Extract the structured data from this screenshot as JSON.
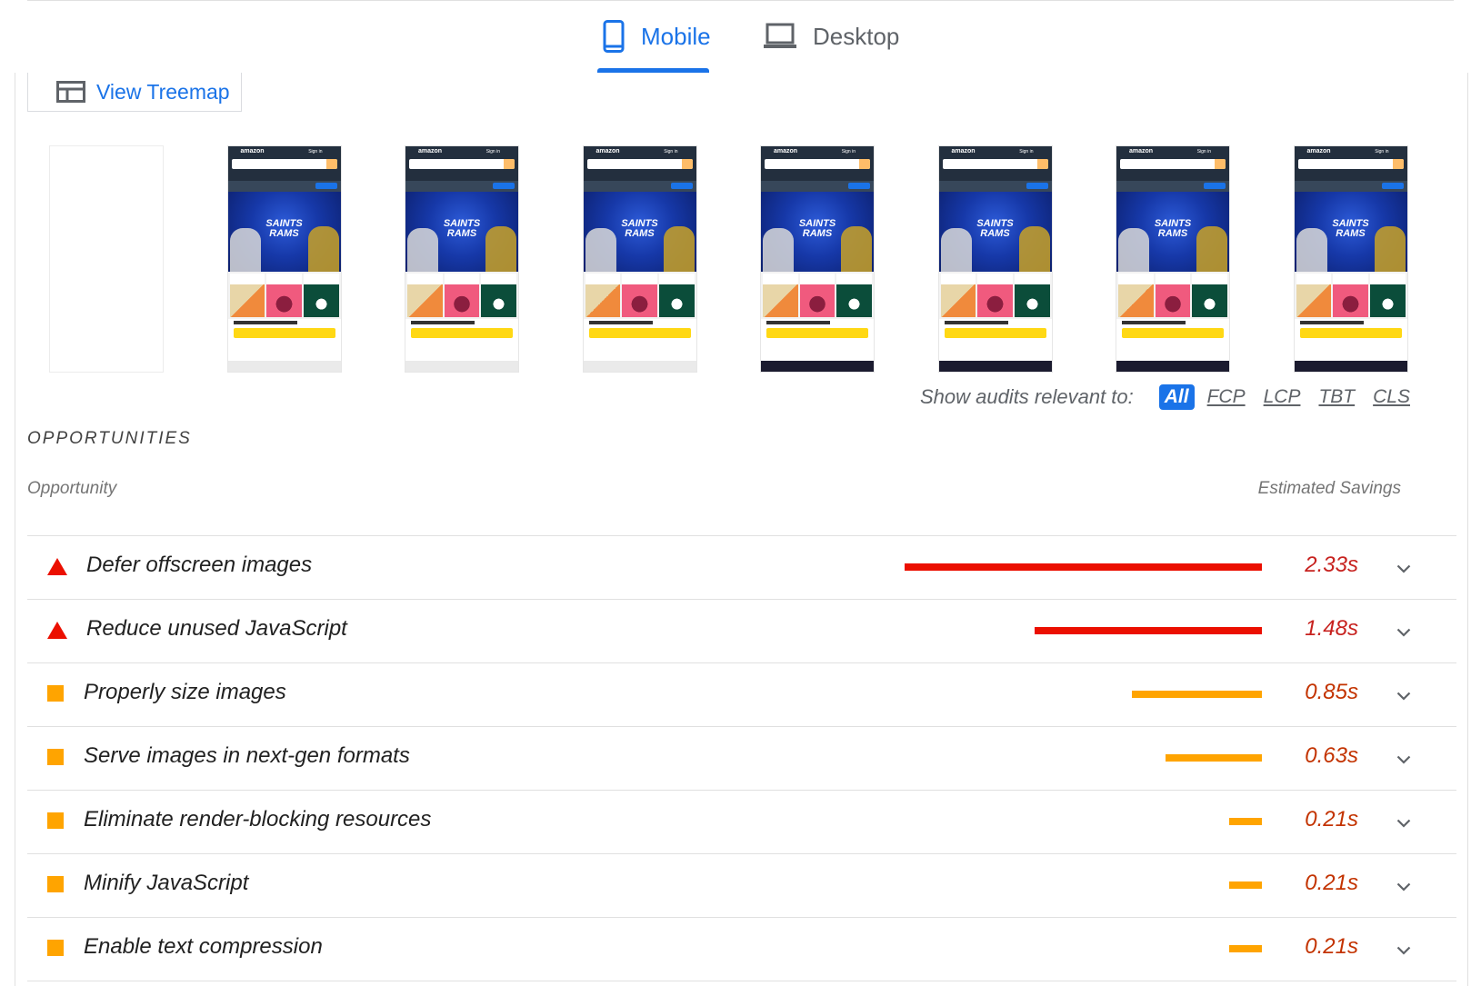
{
  "tabs": {
    "mobile_label": "Mobile",
    "desktop_label": "Desktop",
    "active": "Mobile",
    "accent_color": "#1a73e8"
  },
  "treemap": {
    "label": "View Treemap"
  },
  "filmstrip": {
    "frames": [
      {
        "state": "blank"
      },
      {
        "state": "loaded"
      },
      {
        "state": "loaded"
      },
      {
        "state": "loaded"
      },
      {
        "state": "loaded-footer"
      },
      {
        "state": "loaded-footer"
      },
      {
        "state": "loaded-footer"
      },
      {
        "state": "loaded-footer"
      }
    ]
  },
  "filter": {
    "label": "Show audits relevant to:",
    "chips": [
      "All",
      "FCP",
      "LCP",
      "TBT",
      "CLS"
    ],
    "active": "All"
  },
  "opportunities": {
    "section_title": "OPPORTUNITIES",
    "col_opportunity": "Opportunity",
    "col_savings": "Estimated Savings",
    "colors": {
      "fail": "#eb0f00",
      "average": "#ffa400",
      "fail_text": "#c7221f",
      "average_text": "#c33300"
    },
    "items": [
      {
        "title": "Defer offscreen images",
        "savings": "2.33s",
        "savings_value": 2.33,
        "severity": "fail",
        "icon": "red-triangle-icon"
      },
      {
        "title": "Reduce unused JavaScript",
        "savings": "1.48s",
        "savings_value": 1.48,
        "severity": "fail",
        "icon": "red-triangle-icon"
      },
      {
        "title": "Properly size images",
        "savings": "0.85s",
        "savings_value": 0.85,
        "severity": "average",
        "icon": "orange-square-icon"
      },
      {
        "title": "Serve images in next-gen formats",
        "savings": "0.63s",
        "savings_value": 0.63,
        "severity": "average",
        "icon": "orange-square-icon"
      },
      {
        "title": "Eliminate render-blocking resources",
        "savings": "0.21s",
        "savings_value": 0.21,
        "severity": "average",
        "icon": "orange-square-icon"
      },
      {
        "title": "Minify JavaScript",
        "savings": "0.21s",
        "savings_value": 0.21,
        "severity": "average",
        "icon": "orange-square-icon"
      },
      {
        "title": "Enable text compression",
        "savings": "0.21s",
        "savings_value": 0.21,
        "severity": "average",
        "icon": "orange-square-icon"
      }
    ]
  }
}
